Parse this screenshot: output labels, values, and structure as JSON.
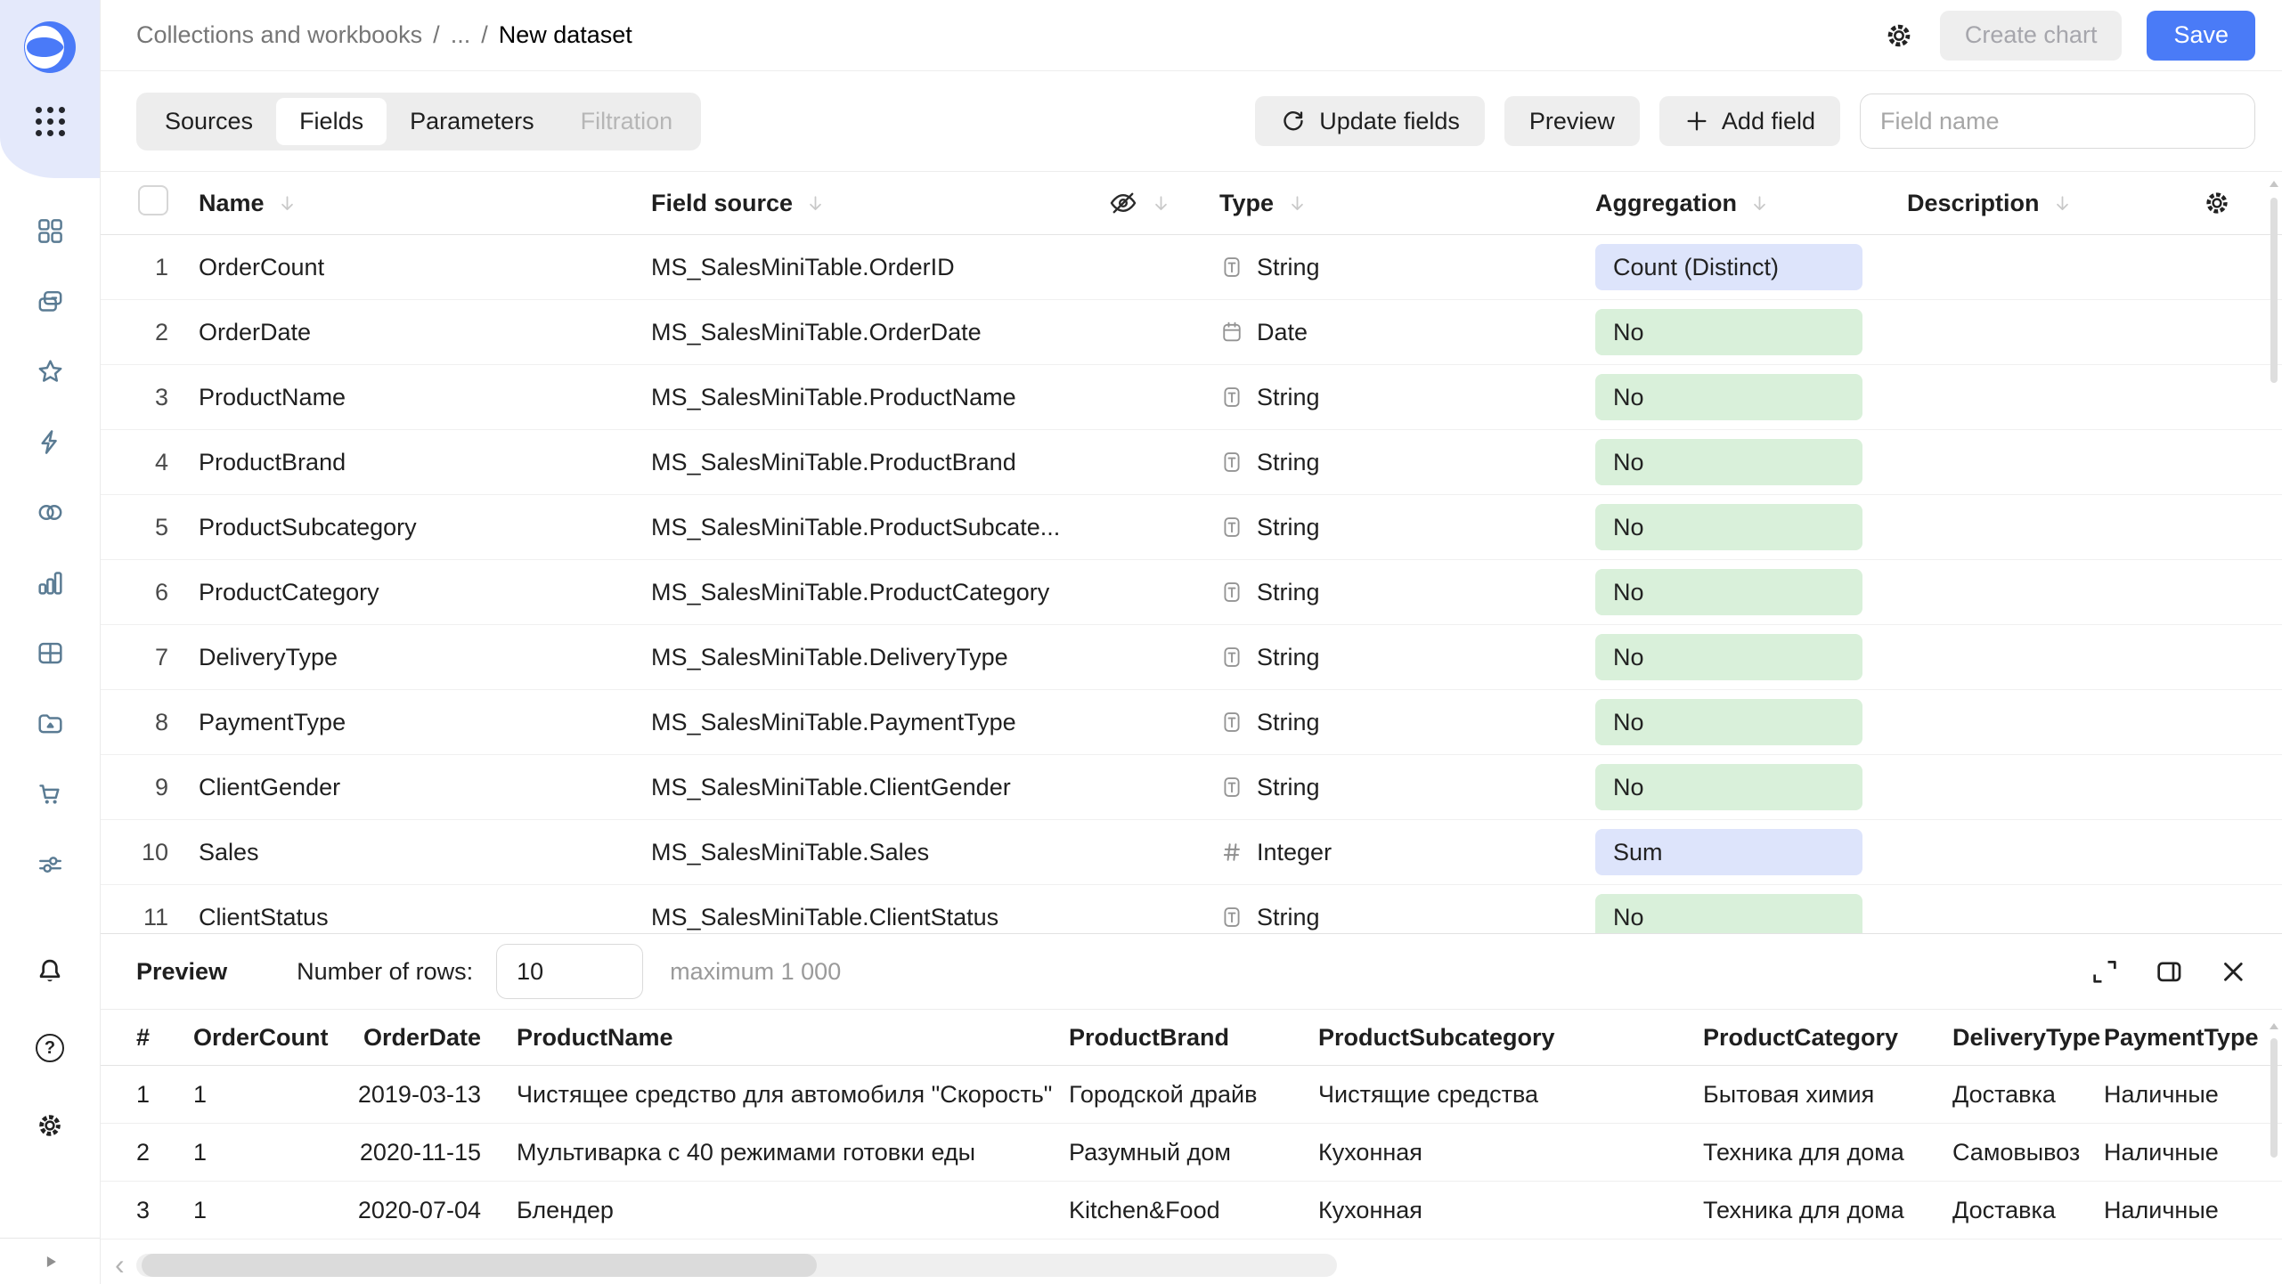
{
  "header": {
    "breadcrumb": {
      "root": "Collections and workbooks",
      "separator": "/",
      "ellipsis": "...",
      "current": "New dataset"
    },
    "create_chart_label": "Create chart",
    "save_label": "Save"
  },
  "toolbar": {
    "tabs": [
      {
        "label": "Sources",
        "state": "normal"
      },
      {
        "label": "Fields",
        "state": "active"
      },
      {
        "label": "Parameters",
        "state": "normal"
      },
      {
        "label": "Filtration",
        "state": "disabled"
      }
    ],
    "update_fields_label": "Update fields",
    "preview_label": "Preview",
    "add_field_label": "Add field",
    "field_name_placeholder": "Field name"
  },
  "fields_table": {
    "columns": {
      "name": "Name",
      "field_source": "Field source",
      "type": "Type",
      "aggregation": "Aggregation",
      "description": "Description"
    },
    "rows": [
      {
        "num": "1",
        "name": "OrderCount",
        "source": "MS_SalesMiniTable.OrderID",
        "type": "String",
        "type_icon": "string",
        "aggregation": "Count (Distinct)",
        "agg_color": "blue"
      },
      {
        "num": "2",
        "name": "OrderDate",
        "source": "MS_SalesMiniTable.OrderDate",
        "type": "Date",
        "type_icon": "date",
        "aggregation": "No",
        "agg_color": "green"
      },
      {
        "num": "3",
        "name": "ProductName",
        "source": "MS_SalesMiniTable.ProductName",
        "type": "String",
        "type_icon": "string",
        "aggregation": "No",
        "agg_color": "green"
      },
      {
        "num": "4",
        "name": "ProductBrand",
        "source": "MS_SalesMiniTable.ProductBrand",
        "type": "String",
        "type_icon": "string",
        "aggregation": "No",
        "agg_color": "green"
      },
      {
        "num": "5",
        "name": "ProductSubcategory",
        "source": "MS_SalesMiniTable.ProductSubcate...",
        "type": "String",
        "type_icon": "string",
        "aggregation": "No",
        "agg_color": "green"
      },
      {
        "num": "6",
        "name": "ProductCategory",
        "source": "MS_SalesMiniTable.ProductCategory",
        "type": "String",
        "type_icon": "string",
        "aggregation": "No",
        "agg_color": "green"
      },
      {
        "num": "7",
        "name": "DeliveryType",
        "source": "MS_SalesMiniTable.DeliveryType",
        "type": "String",
        "type_icon": "string",
        "aggregation": "No",
        "agg_color": "green"
      },
      {
        "num": "8",
        "name": "PaymentType",
        "source": "MS_SalesMiniTable.PaymentType",
        "type": "String",
        "type_icon": "string",
        "aggregation": "No",
        "agg_color": "green"
      },
      {
        "num": "9",
        "name": "ClientGender",
        "source": "MS_SalesMiniTable.ClientGender",
        "type": "String",
        "type_icon": "string",
        "aggregation": "No",
        "agg_color": "green"
      },
      {
        "num": "10",
        "name": "Sales",
        "source": "MS_SalesMiniTable.Sales",
        "type": "Integer",
        "type_icon": "integer",
        "aggregation": "Sum",
        "agg_color": "blue"
      },
      {
        "num": "11",
        "name": "ClientStatus",
        "source": "MS_SalesMiniTable.ClientStatus",
        "type": "String",
        "type_icon": "string",
        "aggregation": "No",
        "agg_color": "green"
      }
    ]
  },
  "preview": {
    "title": "Preview",
    "rows_label": "Number of rows:",
    "rows_value": "10",
    "max_label": "maximum 1 000",
    "table": {
      "columns": [
        "#",
        "OrderCount",
        "OrderDate",
        "ProductName",
        "ProductBrand",
        "ProductSubcategory",
        "ProductCategory",
        "DeliveryType",
        "PaymentType"
      ],
      "rows": [
        [
          "1",
          "1",
          "2019-03-13",
          "Чистящее средство для автомобиля \"Скорость\"",
          "Городской драйв",
          "Чистящие средства",
          "Бытовая химия",
          "Доставка",
          "Наличные"
        ],
        [
          "2",
          "1",
          "2020-11-15",
          "Мультиварка с 40 режимами готовки еды",
          "Разумный дом",
          "Кухонная",
          "Техника для дома",
          "Самовывоз",
          "Наличные"
        ],
        [
          "3",
          "1",
          "2020-07-04",
          "Блендер",
          "Kitchen&Food",
          "Кухонная",
          "Техника для дома",
          "Доставка",
          "Наличные"
        ]
      ]
    }
  },
  "sidebar": {
    "icons": [
      "datalens-logo",
      "apps-grid-icon",
      "dashboards-icon",
      "collections-icon",
      "favorites-star-icon",
      "lightning-icon",
      "relations-circles-icon",
      "charts-icon",
      "table-icon",
      "folder-icon",
      "marketplace-cart-icon",
      "settings-sliders-icon",
      "notifications-bell-icon",
      "help-icon",
      "gear-icon",
      "expand-play-icon"
    ]
  },
  "colors": {
    "accent_blue": "#4a7bf7",
    "sidebar_blob": "#e4e9fb",
    "nav_icon": "#5a7b93",
    "badge_blue": "#dde4fb",
    "badge_green": "#d9f0da"
  }
}
